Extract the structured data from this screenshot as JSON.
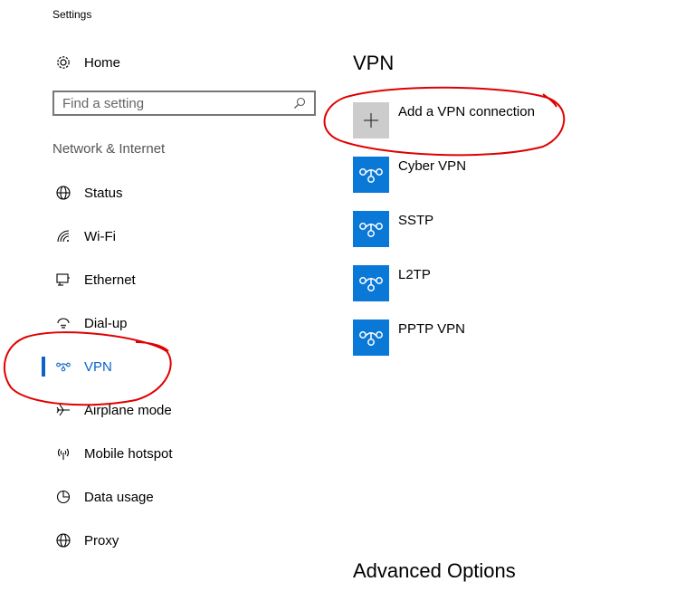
{
  "window": {
    "title": "Settings"
  },
  "sidebar": {
    "home_label": "Home",
    "search_placeholder": "Find a setting",
    "section_heading": "Network & Internet",
    "items": [
      {
        "label": "Status",
        "icon": "globe-icon"
      },
      {
        "label": "Wi-Fi",
        "icon": "wifi-icon"
      },
      {
        "label": "Ethernet",
        "icon": "ethernet-icon"
      },
      {
        "label": "Dial-up",
        "icon": "dial-up-icon"
      },
      {
        "label": "VPN",
        "icon": "vpn-icon",
        "active": true
      },
      {
        "label": "Airplane mode",
        "icon": "airplane-icon"
      },
      {
        "label": "Mobile hotspot",
        "icon": "hotspot-icon"
      },
      {
        "label": "Data usage",
        "icon": "pie-chart-icon"
      },
      {
        "label": "Proxy",
        "icon": "globe-icon"
      }
    ]
  },
  "main": {
    "title": "VPN",
    "add_label": "Add a VPN connection",
    "connections": [
      {
        "name": "Cyber VPN"
      },
      {
        "name": "SSTP"
      },
      {
        "name": "L2TP"
      },
      {
        "name": "PPTP VPN"
      }
    ],
    "advanced_title": "Advanced Options"
  },
  "colors": {
    "accent": "#0a64c8",
    "tile_blue": "#0a78d7",
    "add_tile_gray": "#cccccc",
    "annotation_red": "#e00000"
  }
}
